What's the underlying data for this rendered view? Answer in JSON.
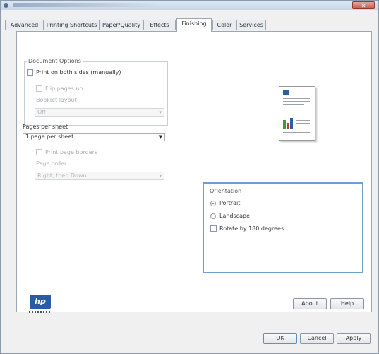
{
  "window": {
    "close_label": "✕"
  },
  "tabs": [
    "Advanced",
    "Printing Shortcuts",
    "Paper/Quality",
    "Effects",
    "Finishing",
    "Color",
    "Services"
  ],
  "document_options": {
    "group_label": "Document Options",
    "print_both_sides": "Print on both sides (manually)",
    "flip_pages_up": "Flip pages up",
    "booklet_layout_label": "Booklet layout",
    "booklet_layout_value": "Off"
  },
  "pages_per_sheet": {
    "label": "Pages per sheet",
    "value": "1 page per sheet",
    "print_page_borders": "Print page borders",
    "page_order_label": "Page order",
    "page_order_value": "Right, then Down"
  },
  "orientation": {
    "group_label": "Orientation",
    "portrait": "Portrait",
    "landscape": "Landscape",
    "rotate_180": "Rotate by 180 degrees",
    "selected": "Portrait"
  },
  "buttons": {
    "about": "About",
    "help": "Help",
    "ok": "OK",
    "cancel": "Cancel",
    "apply": "Apply"
  },
  "logo": {
    "text": "hp"
  },
  "colors": {
    "accent_border": "#6f9fcf",
    "hp_blue": "#2b5aa8",
    "chart_green": "#3f9a3a",
    "chart_red": "#c23b2f"
  }
}
